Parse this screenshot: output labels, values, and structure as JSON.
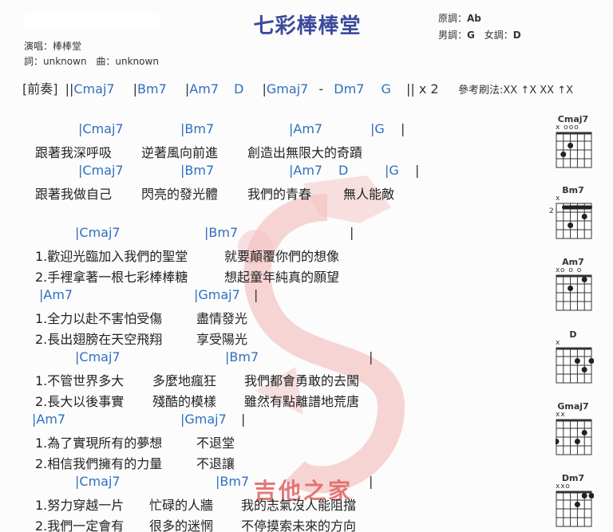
{
  "header": {
    "title": "七彩棒棒堂",
    "original_key_label": "原調：",
    "original_key": "Ab",
    "male_key_label": "男調：",
    "male_key": "G",
    "female_key_label": "女調：",
    "female_key": "D",
    "singer_label": "演唱：",
    "singer": "棒棒堂",
    "lyricist_label": "詞：",
    "lyricist": "unknown",
    "composer_label": "曲：",
    "composer": "unknown"
  },
  "intro": {
    "label": "[前奏]",
    "open": "||",
    "chords": [
      "Cmaj7",
      "Bm7",
      "Am7",
      "D",
      "Gmaj7",
      "-",
      "Dm7",
      "G"
    ],
    "close": "|| x 2"
  },
  "strum": "參考刷法:XX ↑X XX ↑X",
  "verse": {
    "chord_lines": [
      [
        "|Cmaj7",
        "|Bm7",
        "|Am7",
        "|G",
        "|"
      ],
      [
        "|Cmaj7",
        "|Bm7",
        "|Am7",
        "D",
        "|G",
        "|"
      ]
    ],
    "lyric_lines": [
      [
        "跟著我深呼吸",
        "逆著風向前進",
        "創造出無限大的奇蹟"
      ],
      [
        "跟著我做自己",
        "閃亮的發光體",
        "我們的青春",
        "無人能敵"
      ]
    ]
  },
  "chorus": {
    "blocks": [
      {
        "chords": [
          "|Cmaj7",
          "|Bm7",
          "|"
        ],
        "lyrics": [
          [
            "1.歡迎光臨加入我們的聖堂",
            "就要顛覆你們的想像"
          ],
          [
            "2.手裡拿著一根七彩棒棒糖",
            "想起童年純真的願望"
          ]
        ]
      },
      {
        "chords": [
          "|Am7",
          "|Gmaj7",
          "|"
        ],
        "lyrics": [
          [
            "1.全力以赴不害怕受傷",
            "盡情發光"
          ],
          [
            "2.長出翅膀在天空飛翔",
            "享受陽光"
          ]
        ]
      },
      {
        "chords": [
          "|Cmaj7",
          "|Bm7",
          "|"
        ],
        "lyrics": [
          [
            "1.不管世界多大",
            "多麼地瘋狂",
            "我們都會勇敢的去闖"
          ],
          [
            "2.長大以後事實",
            "殘酷的模樣",
            "雖然有點離譜地荒唐"
          ]
        ]
      },
      {
        "chords": [
          "|Am7",
          "|Gmaj7",
          "|"
        ],
        "lyrics": [
          [
            "1.為了實現所有的夢想",
            "不退堂"
          ],
          [
            "2.相信我們擁有的力量",
            "不退讓"
          ]
        ]
      },
      {
        "chords": [
          "|Cmaj7",
          "|Bm7",
          "|"
        ],
        "lyrics": [
          [
            "1.努力穿越一片",
            "忙碌的人牆",
            "我的志氣沒人能阻擋"
          ],
          [
            "2.我們一定會有",
            "很多的迷惘",
            "不停摸索未來的方向"
          ]
        ]
      }
    ]
  },
  "watermark": "吉他之家",
  "chord_diagrams": [
    {
      "name": "Cmaj7",
      "marks": "x  ooo",
      "fret_label": ""
    },
    {
      "name": "Bm7",
      "marks": "x",
      "fret_label": "2"
    },
    {
      "name": "Am7",
      "marks": "xo o o",
      "fret_label": ""
    },
    {
      "name": "D",
      "marks": "x",
      "fret_label": ""
    },
    {
      "name": "Gmaj7",
      "marks": " xx",
      "fret_label": ""
    },
    {
      "name": "Dm7",
      "marks": "xxo",
      "fret_label": ""
    }
  ]
}
